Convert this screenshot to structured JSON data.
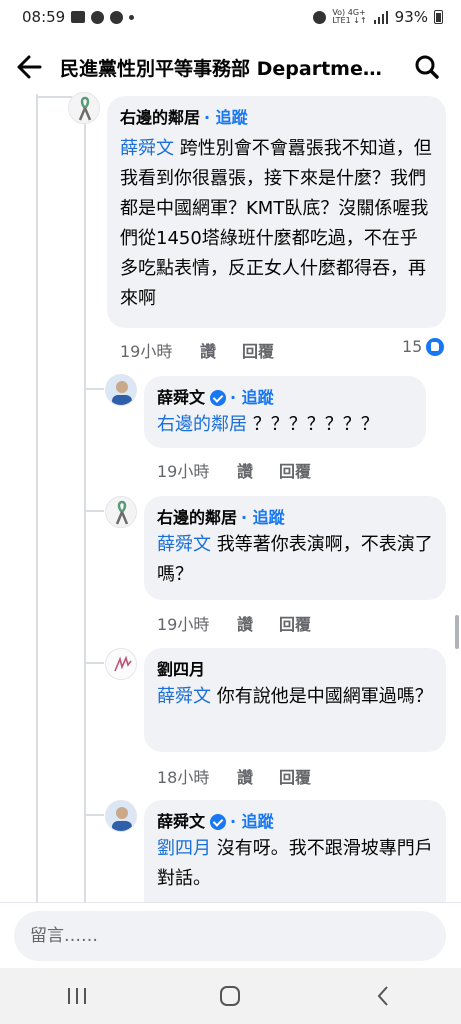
{
  "status_bar": {
    "time": "08:59",
    "network_top": "Vo) 4G+",
    "network_bottom": "LTE1 ↓↑",
    "battery": "93%"
  },
  "header": {
    "title": "民進黨性別平等事務部 Departme…",
    "back_icon": "arrow-left-icon",
    "search_icon": "search-icon"
  },
  "comments": [
    {
      "author": "右邊的鄰居",
      "verified": false,
      "follow": "· 追蹤",
      "mention": "薛舜文",
      "text": " 跨性別會不會囂張我不知道，但我看到你很囂張，接下來是什麼？我們都是中國網軍？KMT臥底？沒關係喔我們從1450塔綠班什麼都吃過，不在乎多吃點表情，反正女人什麼都得吞，再來啊",
      "time": "19小時",
      "like": "讚",
      "reply": "回覆",
      "reaction_count": "15"
    },
    {
      "author": "薛舜文",
      "verified": true,
      "follow": "· 追蹤",
      "mention": "右邊的鄰居",
      "text": " ？？？？？？？",
      "time": "19小時",
      "like": "讚",
      "reply": "回覆"
    },
    {
      "author": "右邊的鄰居",
      "verified": false,
      "follow": "· 追蹤",
      "mention": "薛舜文",
      "text": " 我等著你表演啊，不表演了嗎？",
      "time": "19小時",
      "like": "讚",
      "reply": "回覆"
    },
    {
      "author": "劉四月",
      "verified": false,
      "follow": "",
      "mention": "薛舜文",
      "text": " 你有說他是中國網軍過嗎？",
      "time": "18小時",
      "like": "讚",
      "reply": "回覆"
    },
    {
      "author": "薛舜文",
      "verified": true,
      "follow": "· 追蹤",
      "mention": "劉四月",
      "text": " 沒有呀。我不跟滑坡專門戶對話。",
      "time": "",
      "like": "",
      "reply": ""
    }
  ],
  "input": {
    "placeholder": "留言……"
  },
  "colors": {
    "accent": "#1877f2",
    "mention": "#1a6fd8",
    "bubble": "#f0f2f5",
    "meta": "#65676b"
  }
}
